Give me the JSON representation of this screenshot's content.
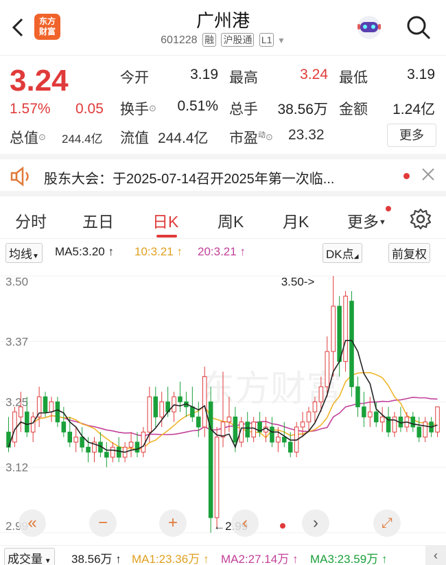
{
  "header": {
    "title": "广州港",
    "code": "601228",
    "tags": [
      "融",
      "沪股通",
      "L1"
    ],
    "logo_line1": "东方",
    "logo_line2": "财富"
  },
  "quote": {
    "price": "3.24",
    "change_pct": "1.57%",
    "change_amt": "0.05",
    "open_label": "今开",
    "open_value": "3.19",
    "high_label": "最高",
    "high_value": "3.24",
    "low_label": "最低",
    "low_value": "3.19",
    "turnover_label": "换手",
    "turnover_value": "0.51%",
    "volume_label": "总手",
    "volume_value": "38.56万",
    "amount_label": "金额",
    "amount_value": "1.24亿",
    "mktcap_label": "总值",
    "mktcap_value": "244.4亿",
    "float_label": "流值",
    "float_value": "244.4亿",
    "pe_label": "市盈",
    "pe_sup": "动",
    "pe_value": "23.32",
    "more_label": "更多"
  },
  "notice": {
    "text": "股东大会：于2025-07-14召开2025年第一次临..."
  },
  "tabs": [
    "分时",
    "五日",
    "日K",
    "周K",
    "月K",
    "更多"
  ],
  "active_tab": "日K",
  "ma_bar": {
    "type_label": "均线",
    "ma5": "MA5:3.20 ↑",
    "ma10": "10:3.21 ↑",
    "ma20": "20:3.21 ↑",
    "dk_label": "DK点",
    "adjust_label": "前复权"
  },
  "chart": {
    "y_labels": [
      "3.50",
      "3.37",
      "3.25",
      "3.12",
      "2.99"
    ],
    "high_annotation": "3.50->",
    "low_annotation": "←2.99",
    "watermark": "东方财富",
    "colors": {
      "up": "#e03a3a",
      "down": "#1aa03a",
      "ma5": "#222222",
      "ma10": "#f0b429",
      "ma20": "#c2409a"
    }
  },
  "chart_data": {
    "type": "candlestick",
    "ylim": [
      2.99,
      3.5
    ],
    "y_ticks": [
      3.5,
      3.37,
      3.25,
      3.12,
      2.99
    ],
    "max_marker": 3.5,
    "min_marker": 2.99,
    "candles": [
      {
        "o": 3.19,
        "h": 3.22,
        "l": 3.15,
        "c": 3.16
      },
      {
        "o": 3.17,
        "h": 3.24,
        "l": 3.16,
        "c": 3.23
      },
      {
        "o": 3.22,
        "h": 3.27,
        "l": 3.19,
        "c": 3.24
      },
      {
        "o": 3.23,
        "h": 3.26,
        "l": 3.18,
        "c": 3.19
      },
      {
        "o": 3.19,
        "h": 3.23,
        "l": 3.17,
        "c": 3.22
      },
      {
        "o": 3.22,
        "h": 3.28,
        "l": 3.2,
        "c": 3.26
      },
      {
        "o": 3.26,
        "h": 3.27,
        "l": 3.22,
        "c": 3.23
      },
      {
        "o": 3.23,
        "h": 3.26,
        "l": 3.21,
        "c": 3.25
      },
      {
        "o": 3.25,
        "h": 3.26,
        "l": 3.2,
        "c": 3.21
      },
      {
        "o": 3.21,
        "h": 3.24,
        "l": 3.18,
        "c": 3.19
      },
      {
        "o": 3.19,
        "h": 3.22,
        "l": 3.16,
        "c": 3.17
      },
      {
        "o": 3.17,
        "h": 3.2,
        "l": 3.15,
        "c": 3.18
      },
      {
        "o": 3.18,
        "h": 3.2,
        "l": 3.15,
        "c": 3.16
      },
      {
        "o": 3.16,
        "h": 3.18,
        "l": 3.13,
        "c": 3.15
      },
      {
        "o": 3.15,
        "h": 3.18,
        "l": 3.13,
        "c": 3.17
      },
      {
        "o": 3.17,
        "h": 3.19,
        "l": 3.14,
        "c": 3.15
      },
      {
        "o": 3.15,
        "h": 3.17,
        "l": 3.12,
        "c": 3.14
      },
      {
        "o": 3.14,
        "h": 3.17,
        "l": 3.13,
        "c": 3.16
      },
      {
        "o": 3.16,
        "h": 3.18,
        "l": 3.13,
        "c": 3.14
      },
      {
        "o": 3.14,
        "h": 3.17,
        "l": 3.13,
        "c": 3.16
      },
      {
        "o": 3.16,
        "h": 3.19,
        "l": 3.14,
        "c": 3.17
      },
      {
        "o": 3.17,
        "h": 3.19,
        "l": 3.14,
        "c": 3.15
      },
      {
        "o": 3.15,
        "h": 3.2,
        "l": 3.14,
        "c": 3.19
      },
      {
        "o": 3.19,
        "h": 3.28,
        "l": 3.17,
        "c": 3.26
      },
      {
        "o": 3.26,
        "h": 3.28,
        "l": 3.2,
        "c": 3.22
      },
      {
        "o": 3.22,
        "h": 3.27,
        "l": 3.2,
        "c": 3.25
      },
      {
        "o": 3.25,
        "h": 3.28,
        "l": 3.22,
        "c": 3.23
      },
      {
        "o": 3.23,
        "h": 3.27,
        "l": 3.21,
        "c": 3.26
      },
      {
        "o": 3.26,
        "h": 3.29,
        "l": 3.23,
        "c": 3.25
      },
      {
        "o": 3.25,
        "h": 3.27,
        "l": 3.22,
        "c": 3.24
      },
      {
        "o": 3.24,
        "h": 3.28,
        "l": 3.21,
        "c": 3.22
      },
      {
        "o": 3.22,
        "h": 3.25,
        "l": 3.18,
        "c": 3.2
      },
      {
        "o": 3.2,
        "h": 3.32,
        "l": 3.18,
        "c": 3.3
      },
      {
        "o": 3.25,
        "h": 3.28,
        "l": 2.99,
        "c": 3.02
      },
      {
        "o": 3.02,
        "h": 3.2,
        "l": 3.0,
        "c": 3.18
      },
      {
        "o": 3.18,
        "h": 3.31,
        "l": 3.16,
        "c": 3.21
      },
      {
        "o": 3.21,
        "h": 3.26,
        "l": 3.19,
        "c": 3.22
      },
      {
        "o": 3.22,
        "h": 3.24,
        "l": 3.15,
        "c": 3.17
      },
      {
        "o": 3.17,
        "h": 3.22,
        "l": 3.16,
        "c": 3.21
      },
      {
        "o": 3.21,
        "h": 3.23,
        "l": 3.17,
        "c": 3.18
      },
      {
        "o": 3.18,
        "h": 3.22,
        "l": 3.17,
        "c": 3.21
      },
      {
        "o": 3.21,
        "h": 3.23,
        "l": 3.18,
        "c": 3.19
      },
      {
        "o": 3.19,
        "h": 3.22,
        "l": 3.17,
        "c": 3.2
      },
      {
        "o": 3.2,
        "h": 3.22,
        "l": 3.16,
        "c": 3.17
      },
      {
        "o": 3.17,
        "h": 3.2,
        "l": 3.15,
        "c": 3.18
      },
      {
        "o": 3.18,
        "h": 3.21,
        "l": 3.16,
        "c": 3.17
      },
      {
        "o": 3.17,
        "h": 3.19,
        "l": 3.14,
        "c": 3.15
      },
      {
        "o": 3.15,
        "h": 3.21,
        "l": 3.14,
        "c": 3.2
      },
      {
        "o": 3.2,
        "h": 3.23,
        "l": 3.18,
        "c": 3.21
      },
      {
        "o": 3.21,
        "h": 3.24,
        "l": 3.19,
        "c": 3.23
      },
      {
        "o": 3.23,
        "h": 3.26,
        "l": 3.21,
        "c": 3.25
      },
      {
        "o": 3.25,
        "h": 3.3,
        "l": 3.23,
        "c": 3.28
      },
      {
        "o": 3.28,
        "h": 3.38,
        "l": 3.26,
        "c": 3.35
      },
      {
        "o": 3.35,
        "h": 3.5,
        "l": 3.3,
        "c": 3.44
      },
      {
        "o": 3.44,
        "h": 3.46,
        "l": 3.3,
        "c": 3.33
      },
      {
        "o": 3.33,
        "h": 3.47,
        "l": 3.31,
        "c": 3.46
      },
      {
        "o": 3.45,
        "h": 3.47,
        "l": 3.26,
        "c": 3.28
      },
      {
        "o": 3.28,
        "h": 3.3,
        "l": 3.22,
        "c": 3.24
      },
      {
        "o": 3.24,
        "h": 3.27,
        "l": 3.2,
        "c": 3.22
      },
      {
        "o": 3.22,
        "h": 3.26,
        "l": 3.2,
        "c": 3.23
      },
      {
        "o": 3.23,
        "h": 3.25,
        "l": 3.2,
        "c": 3.21
      },
      {
        "o": 3.21,
        "h": 3.24,
        "l": 3.19,
        "c": 3.22
      },
      {
        "o": 3.22,
        "h": 3.24,
        "l": 3.18,
        "c": 3.19
      },
      {
        "o": 3.19,
        "h": 3.23,
        "l": 3.18,
        "c": 3.22
      },
      {
        "o": 3.22,
        "h": 3.24,
        "l": 3.19,
        "c": 3.2
      },
      {
        "o": 3.2,
        "h": 3.23,
        "l": 3.19,
        "c": 3.22
      },
      {
        "o": 3.22,
        "h": 3.23,
        "l": 3.19,
        "c": 3.2
      },
      {
        "o": 3.2,
        "h": 3.22,
        "l": 3.17,
        "c": 3.18
      },
      {
        "o": 3.18,
        "h": 3.22,
        "l": 3.17,
        "c": 3.21
      },
      {
        "o": 3.21,
        "h": 3.22,
        "l": 3.18,
        "c": 3.19
      },
      {
        "o": 3.19,
        "h": 3.24,
        "l": 3.18,
        "c": 3.24
      }
    ]
  },
  "controls": {
    "rewind": "«",
    "zoom_out": "−",
    "zoom_in": "+",
    "prev": "‹",
    "next": "›",
    "fullscreen": "⤢"
  },
  "volume_bar": {
    "label": "成交量",
    "vol": "38.56万 ↑",
    "ma1": "MA1:23.36万 ↑",
    "ma2": "MA2:27.14万 ↑",
    "ma3": "MA3:23.59万 ↑",
    "collapse_icon": "‹"
  }
}
